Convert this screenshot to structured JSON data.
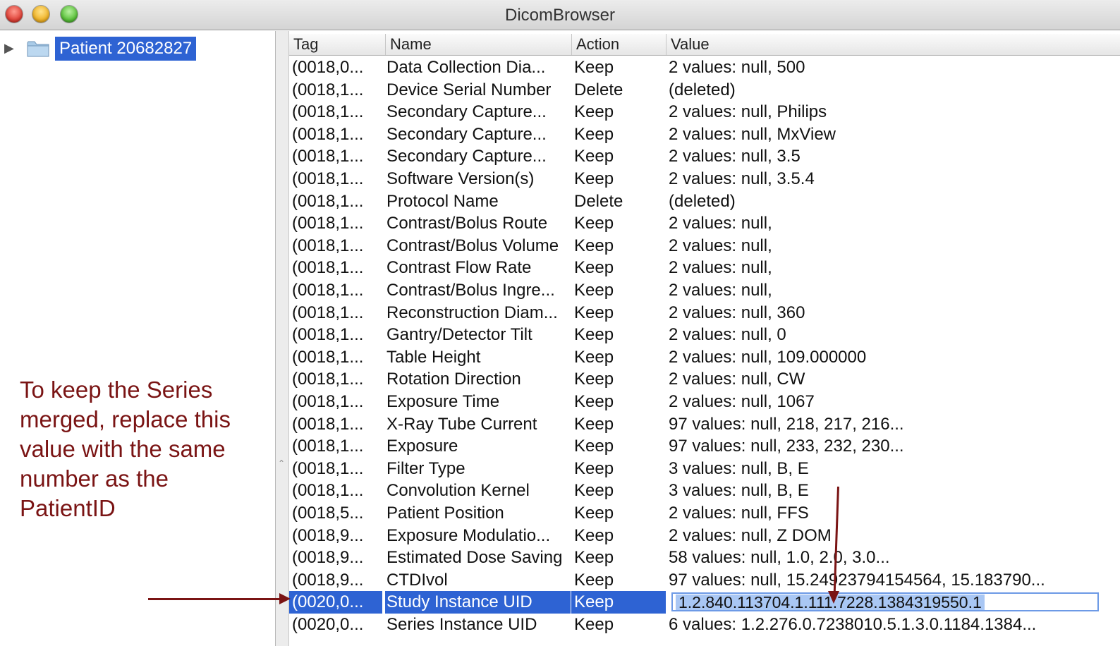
{
  "window": {
    "title": "DicomBrowser"
  },
  "tree": {
    "root_label": "Patient 20682827"
  },
  "annotation": {
    "text": "To keep the Series merged, replace this value with the same number as the PatientID"
  },
  "table": {
    "columns": {
      "tag": "Tag",
      "name": "Name",
      "action": "Action",
      "value": "Value"
    },
    "rows": [
      {
        "tag": "(0018,0...",
        "name": "Data Collection Dia...",
        "action": "Keep",
        "value": "2 values: null, 500"
      },
      {
        "tag": "(0018,1...",
        "name": "Device Serial Number",
        "action": "Delete",
        "value": "(deleted)"
      },
      {
        "tag": "(0018,1...",
        "name": "Secondary Capture...",
        "action": "Keep",
        "value": "2 values: null, Philips"
      },
      {
        "tag": "(0018,1...",
        "name": "Secondary Capture...",
        "action": "Keep",
        "value": "2 values: null, MxView"
      },
      {
        "tag": "(0018,1...",
        "name": "Secondary Capture...",
        "action": "Keep",
        "value": "2 values: null, 3.5"
      },
      {
        "tag": "(0018,1...",
        "name": "Software Version(s)",
        "action": "Keep",
        "value": "2 values: null, 3.5.4"
      },
      {
        "tag": "(0018,1...",
        "name": "Protocol Name",
        "action": "Delete",
        "value": "(deleted)"
      },
      {
        "tag": "(0018,1...",
        "name": "Contrast/Bolus Route",
        "action": "Keep",
        "value": "2 values: null,"
      },
      {
        "tag": "(0018,1...",
        "name": "Contrast/Bolus Volume",
        "action": "Keep",
        "value": "2 values: null,"
      },
      {
        "tag": "(0018,1...",
        "name": "Contrast Flow Rate",
        "action": "Keep",
        "value": "2 values: null,"
      },
      {
        "tag": "(0018,1...",
        "name": "Contrast/Bolus Ingre...",
        "action": "Keep",
        "value": "2 values: null,"
      },
      {
        "tag": "(0018,1...",
        "name": "Reconstruction Diam...",
        "action": "Keep",
        "value": "2 values: null, 360"
      },
      {
        "tag": "(0018,1...",
        "name": "Gantry/Detector Tilt",
        "action": "Keep",
        "value": "2 values: null, 0"
      },
      {
        "tag": "(0018,1...",
        "name": "Table Height",
        "action": "Keep",
        "value": "2 values: null, 109.000000"
      },
      {
        "tag": "(0018,1...",
        "name": "Rotation Direction",
        "action": "Keep",
        "value": "2 values: null, CW"
      },
      {
        "tag": "(0018,1...",
        "name": "Exposure Time",
        "action": "Keep",
        "value": "2 values: null, 1067"
      },
      {
        "tag": "(0018,1...",
        "name": "X-Ray Tube Current",
        "action": "Keep",
        "value": "97 values: null, 218, 217, 216..."
      },
      {
        "tag": "(0018,1...",
        "name": "Exposure",
        "action": "Keep",
        "value": "97 values: null, 233, 232, 230..."
      },
      {
        "tag": "(0018,1...",
        "name": "Filter Type",
        "action": "Keep",
        "value": "3 values: null, B, E"
      },
      {
        "tag": "(0018,1...",
        "name": "Convolution Kernel",
        "action": "Keep",
        "value": "3 values: null, B, E"
      },
      {
        "tag": "(0018,5...",
        "name": "Patient Position",
        "action": "Keep",
        "value": "2 values: null, FFS"
      },
      {
        "tag": "(0018,9...",
        "name": "Exposure Modulatio...",
        "action": "Keep",
        "value": "2 values: null, Z DOM"
      },
      {
        "tag": "(0018,9...",
        "name": "Estimated Dose Saving",
        "action": "Keep",
        "value": "58 values: null, 1.0, 2.0, 3.0..."
      },
      {
        "tag": "(0018,9...",
        "name": "CTDIvol",
        "action": "Keep",
        "value": "97 values: null, 15.24923794154564, 15.183790..."
      },
      {
        "tag": "(0020,0...",
        "name": "Study Instance UID",
        "action": "Keep",
        "value": "1.2.840.113704.1.111.7228.1384319550.1"
      },
      {
        "tag": "(0020,0...",
        "name": "Series Instance UID",
        "action": "Keep",
        "value": "6 values: 1.2.276.0.7238010.5.1.3.0.1184.1384..."
      }
    ]
  }
}
